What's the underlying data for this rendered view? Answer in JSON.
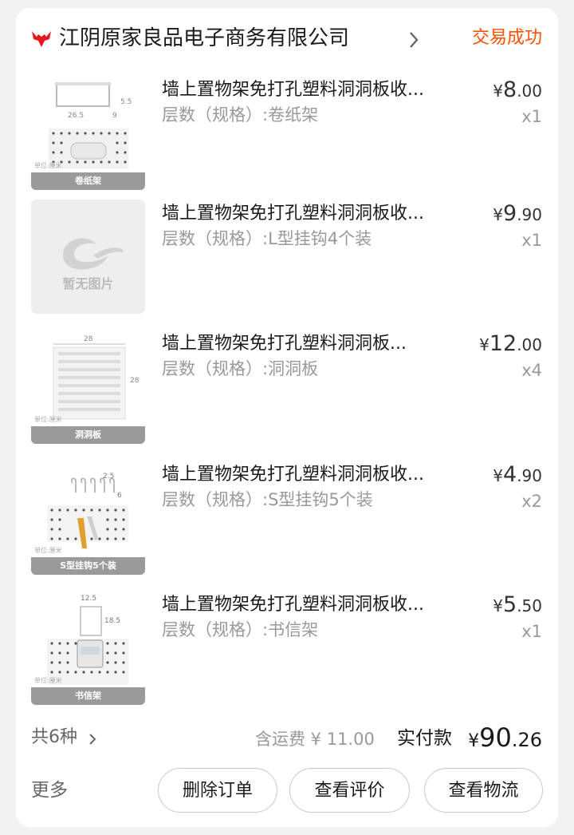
{
  "shop": {
    "name": "江阴原家良品电子商务有限公司",
    "status": "交易成功",
    "icon": "shop-bull-icon",
    "status_color": "#ff5000"
  },
  "items": [
    {
      "title": "墙上置物架免打孔塑料洞洞板收...",
      "spec": "层数（规格）:卷纸架",
      "price_currency": "¥",
      "price_int": "8",
      "price_dec": ".00",
      "qty": "x1",
      "thumb_label": "卷纸架",
      "thumb_unit": "单位:厘米",
      "dims": [
        "26.5",
        "5.5",
        "9"
      ]
    },
    {
      "title": "墙上置物架免打孔塑料洞洞板收...",
      "spec": "层数（规格）:L型挂钩4个装",
      "price_currency": "¥",
      "price_int": "9",
      "price_dec": ".90",
      "qty": "x1",
      "thumb_empty_text": "暂无图片"
    },
    {
      "title": "墙上置物架免打孔塑料洞洞板...",
      "spec": "层数（规格）:洞洞板",
      "price_currency": "¥",
      "price_int": "12",
      "price_dec": ".00",
      "qty": "x4",
      "thumb_label": "洞洞板",
      "thumb_unit": "单位:厘米",
      "dims": [
        "28",
        "28"
      ]
    },
    {
      "title": "墙上置物架免打孔塑料洞洞板收...",
      "spec": "层数（规格）:S型挂钩5个装",
      "price_currency": "¥",
      "price_int": "4",
      "price_dec": ".90",
      "qty": "x2",
      "thumb_label": "S型挂钩5个装",
      "thumb_unit": "单位:厘米",
      "dims": [
        "2.5",
        "6"
      ]
    },
    {
      "title": "墙上置物架免打孔塑料洞洞板收...",
      "spec": "层数（规格）:书信架",
      "price_currency": "¥",
      "price_int": "5",
      "price_dec": ".50",
      "qty": "x1",
      "thumb_label": "书信架",
      "thumb_unit": "单位:厘米",
      "dims": [
        "12.5",
        "18.5"
      ]
    }
  ],
  "summary": {
    "count": "共6种",
    "freight": "含运费 ¥ 11.00",
    "paid_label": "实付款",
    "paid_currency": "¥",
    "paid_int": "90",
    "paid_dec": ".26"
  },
  "actions": {
    "more": "更多",
    "delete": "删除订单",
    "review": "查看评价",
    "logistics": "查看物流"
  }
}
